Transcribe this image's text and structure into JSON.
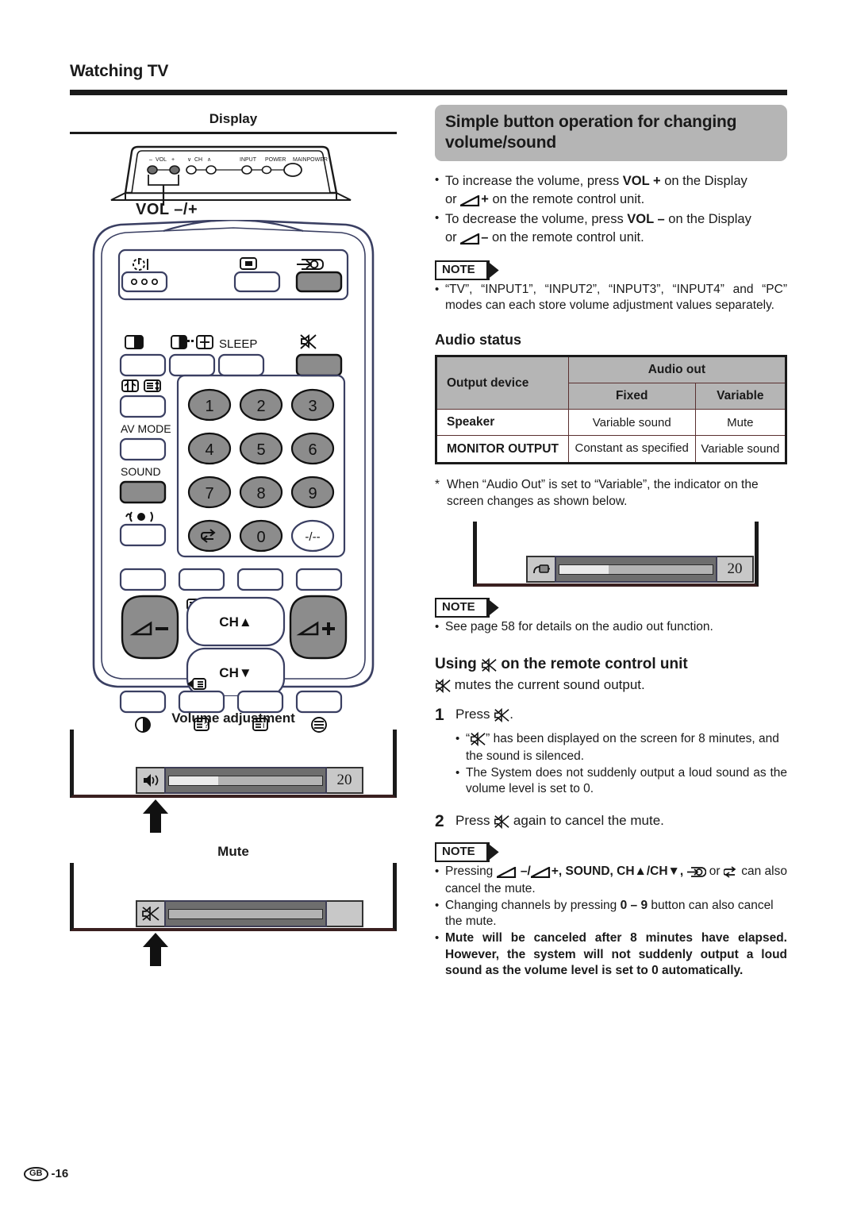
{
  "page": {
    "chapter_title": "Watching TV",
    "footer_region": "GB",
    "footer_page": "-16"
  },
  "left": {
    "display_label": "Display",
    "panel_buttons": {
      "vol_label": "VOL",
      "vol_minus": "–",
      "vol_plus": "+",
      "ch_label": "CH",
      "ch_down": "∨",
      "ch_up": "∧",
      "input": "INPUT",
      "power": "POWER",
      "mainpower": "MAINPOWER"
    },
    "vol_caption": "VOL –/+",
    "remote": {
      "sleep": "SLEEP",
      "av_mode": "AV MODE",
      "sound": "SOUND",
      "ch_up": "CH▲",
      "ch_down": "CH▼",
      "vol_minus": "–",
      "vol_plus": "+",
      "dash": "-/--",
      "keys": [
        "1",
        "2",
        "3",
        "4",
        "5",
        "6",
        "7",
        "8",
        "9",
        "0"
      ]
    },
    "volume_osd": {
      "title": "Volume adjustment",
      "icon": "speaker-on-icon",
      "value": "20",
      "fill_percent": 32
    },
    "mute_osd": {
      "title": "Mute",
      "icon": "speaker-mute-icon",
      "value": "",
      "fill_percent": 0
    }
  },
  "right": {
    "banner_title": "Simple button operation for changing volume/sound",
    "intro_bullets": [
      {
        "part1": "To increase the volume, press ",
        "bold1": "VOL +",
        "part2": " on the Display",
        "line2_pre": "or ",
        "icon": "volume-wedge-icon",
        "sign": "+",
        "line2_post": " on the remote control unit."
      },
      {
        "part1": "To decrease the volume, press ",
        "bold1": "VOL –",
        "part2": " on the Display",
        "line2_pre": "or ",
        "icon": "volume-wedge-icon",
        "sign": "–",
        "line2_post": " on the remote control unit."
      }
    ],
    "note_label": "NOTE",
    "note1_text": "“TV”, “INPUT1”, “INPUT2”, “INPUT3”, “INPUT4” and “PC” modes can each store volume adjustment values separately.",
    "audio_status_title": "Audio status",
    "audio_table": {
      "col_device": "Output device",
      "col_group": "Audio out",
      "col_fixed": "Fixed",
      "col_variable": "Variable",
      "rows": [
        {
          "device": "Speaker",
          "fixed": "Variable sound",
          "variable": "Mute"
        },
        {
          "device": "MONITOR OUTPUT",
          "fixed": "Constant as specified",
          "variable": "Variable sound"
        }
      ]
    },
    "footnote": "When “Audio Out” is set to “Variable”, the indicator on the screen changes as shown below.",
    "footnote_marker": "*",
    "audio_out_osd": {
      "icon": "output-plug-icon",
      "value": "20",
      "fill_percent": 32
    },
    "note2_text": "See page 58 for details on the audio out function.",
    "mute_section": {
      "heading_pre": "Using ",
      "heading_icon": "mute-icon",
      "heading_post": " on the remote control unit",
      "lead_icon": "mute-icon",
      "lead_text": " mutes the current sound output.",
      "steps": [
        {
          "num": "1",
          "text_pre": "Press ",
          "icon": "mute-icon",
          "text_post": ".",
          "bullets": [
            {
              "pre": "“",
              "icon": "mute-icon",
              "post": "” has been displayed on the screen for 8 minutes, and the sound is silenced."
            },
            {
              "pre": "",
              "icon": "",
              "post": "The System does not suddenly output a loud sound as the volume level is set to 0."
            }
          ]
        },
        {
          "num": "2",
          "text_pre": "Press ",
          "icon": "mute-icon",
          "text_post": " again to cancel the mute.",
          "bullets": []
        }
      ]
    },
    "note3_bullets": [
      {
        "pre": "Pressing ",
        "mid": " –/",
        "mid2": "+",
        "bold_list": ", SOUND, CH▲/CH▼, ",
        "tail": " or ",
        "tail2": " can also cancel the mute.",
        "bold": false
      },
      {
        "pre": "Changing channels by pressing ",
        "bold_mid": "0 – 9",
        "post": " button can also cancel the mute.",
        "bold": false
      },
      {
        "pre": "Mute will be canceled after 8 minutes have elapsed. However, the system will not suddenly output a loud sound as the volume level is set to 0 automatically.",
        "bold": true
      }
    ]
  }
}
